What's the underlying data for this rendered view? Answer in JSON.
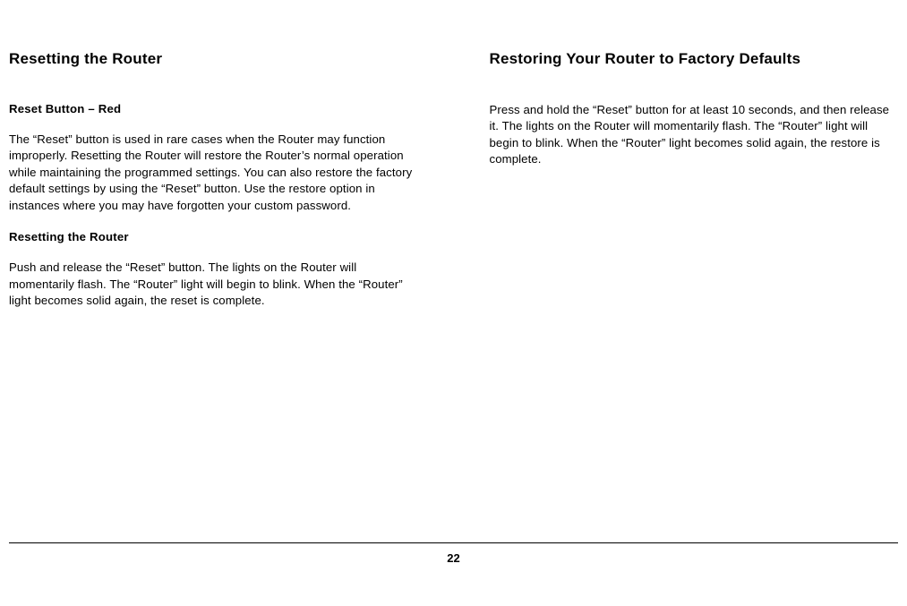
{
  "left": {
    "title": "Resetting the Router",
    "sub1": "Reset Button – Red",
    "para1": "The “Reset” button is used in rare cases when the Router may function improperly. Resetting the Router will restore the Router’s normal operation while maintaining the programmed settings. You can also restore the factory default settings by using the “Reset” button. Use the restore option in instances where you may have forgotten your custom password.",
    "sub2": "Resetting the Router",
    "para2": "Push and release the “Reset” button. The lights on the Router will momentarily flash. The “Router” light will begin to blink. When the “Router” light becomes solid again, the reset is complete."
  },
  "right": {
    "title": "Restoring Your Router to Factory Defaults",
    "para1": "Press and hold the “Reset” button for at least 10 seconds, and then release it. The lights on the Router will momentarily flash. The “Router” light will begin to blink. When the “Router” light becomes solid again, the restore is complete."
  },
  "page_number": "22"
}
